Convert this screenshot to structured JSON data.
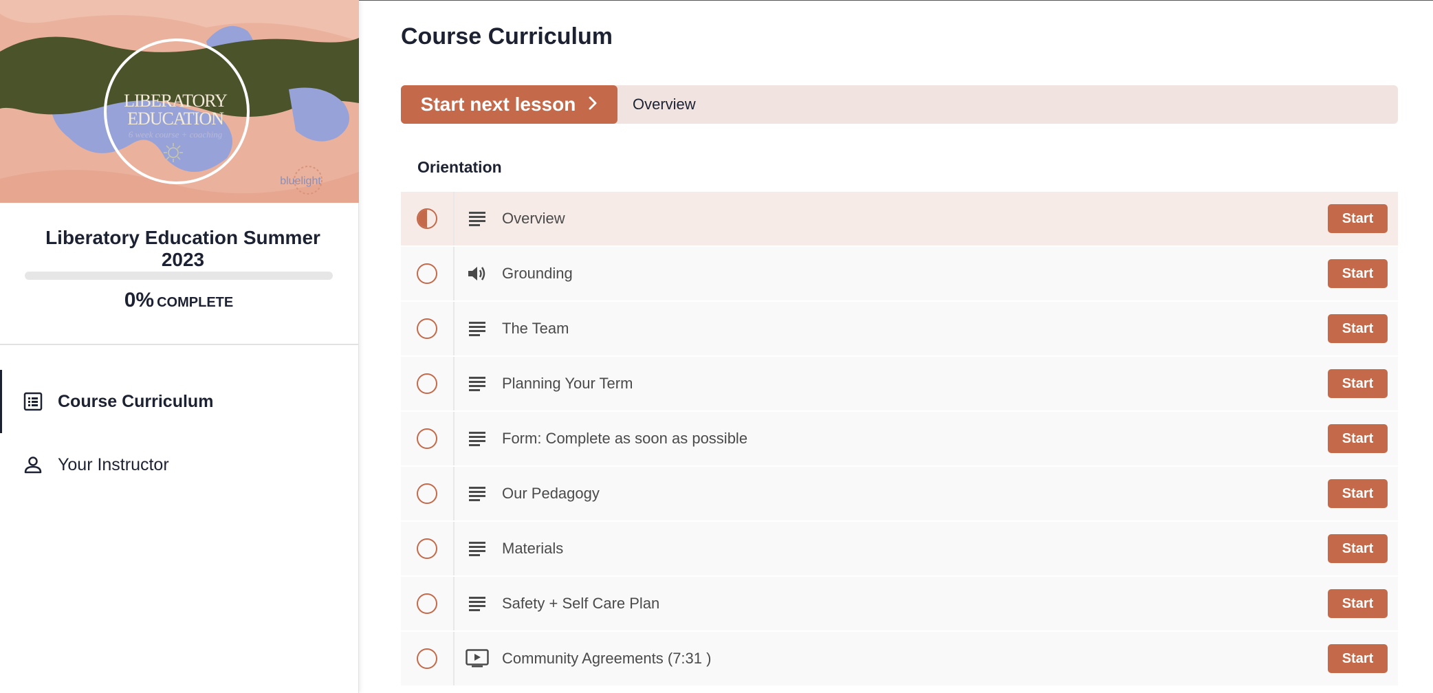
{
  "sidebar": {
    "banner": {
      "title_line1": "LIBERATORY",
      "title_line2": "EDUCATION",
      "subtitle": "6 week course + coaching",
      "brand": "bluelight"
    },
    "course_title": "Liberatory Education Summer 2023",
    "progress": {
      "percent_value": 0,
      "percent_text": "0%",
      "label": "COMPLETE"
    },
    "nav": [
      {
        "label": "Course Curriculum",
        "icon": "curriculum-list-icon",
        "active": true
      },
      {
        "label": "Your Instructor",
        "icon": "person-icon",
        "active": false
      }
    ]
  },
  "main": {
    "page_title": "Course Curriculum",
    "next_lesson": {
      "button_label": "Start next lesson",
      "target": "Overview"
    },
    "section": {
      "title": "Orientation",
      "lessons": [
        {
          "title": "Overview",
          "type": "text",
          "status": "in-progress",
          "action": "Start"
        },
        {
          "title": "Grounding",
          "type": "audio",
          "status": "not-started",
          "action": "Start"
        },
        {
          "title": "The Team",
          "type": "text",
          "status": "not-started",
          "action": "Start"
        },
        {
          "title": "Planning Your Term",
          "type": "text",
          "status": "not-started",
          "action": "Start"
        },
        {
          "title": "Form: Complete as soon as possible",
          "type": "text",
          "status": "not-started",
          "action": "Start"
        },
        {
          "title": "Our Pedagogy",
          "type": "text",
          "status": "not-started",
          "action": "Start"
        },
        {
          "title": "Materials",
          "type": "text",
          "status": "not-started",
          "action": "Start"
        },
        {
          "title": "Safety + Self Care Plan",
          "type": "text",
          "status": "not-started",
          "action": "Start"
        },
        {
          "title": "Community Agreements (7:31 )",
          "type": "video",
          "status": "not-started",
          "action": "Start"
        }
      ]
    }
  },
  "colors": {
    "accent": "#c4694a",
    "text_dark": "#1d2233",
    "bar_bg": "#f1e3df",
    "row_current": "#f7ebe8"
  }
}
